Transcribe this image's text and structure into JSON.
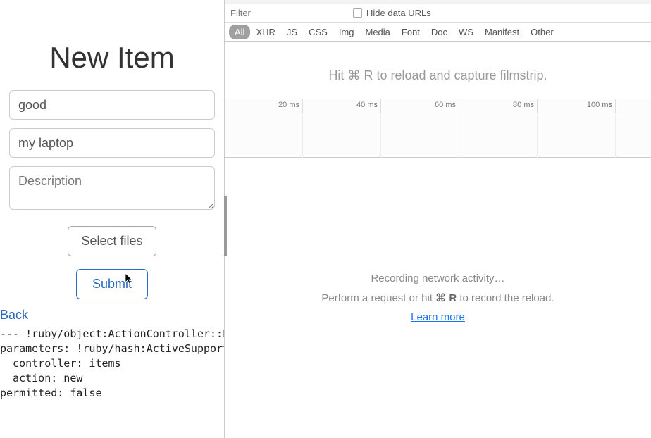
{
  "form": {
    "title": "New Item",
    "field1_value": "good",
    "field2_value": "my laptop",
    "description_placeholder": "Description",
    "select_files_label": "Select files",
    "submit_label": "Submit",
    "back_label": "Back"
  },
  "codedump": "--- !ruby/object:ActionController::Par\nparameters: !ruby/hash:ActiveSupport::\n  controller: items\n  action: new\npermitted: false",
  "devtools": {
    "filter_placeholder": "Filter",
    "hide_data_urls_label": "Hide data URLs",
    "type_filters": [
      "All",
      "XHR",
      "JS",
      "CSS",
      "Img",
      "Media",
      "Font",
      "Doc",
      "WS",
      "Manifest",
      "Other"
    ],
    "active_filter": "All",
    "filmstrip_hint_prefix": "Hit ",
    "filmstrip_hint_cmd": "⌘ R",
    "filmstrip_hint_suffix": " to reload and capture filmstrip.",
    "timeline_ticks": [
      "20 ms",
      "40 ms",
      "60 ms",
      "80 ms",
      "100 ms"
    ],
    "empty": {
      "line1": "Recording network activity…",
      "line2_prefix": "Perform a request or hit ",
      "line2_cmd": "⌘ R",
      "line2_suffix": " to record the reload.",
      "learn_more": "Learn more"
    }
  }
}
